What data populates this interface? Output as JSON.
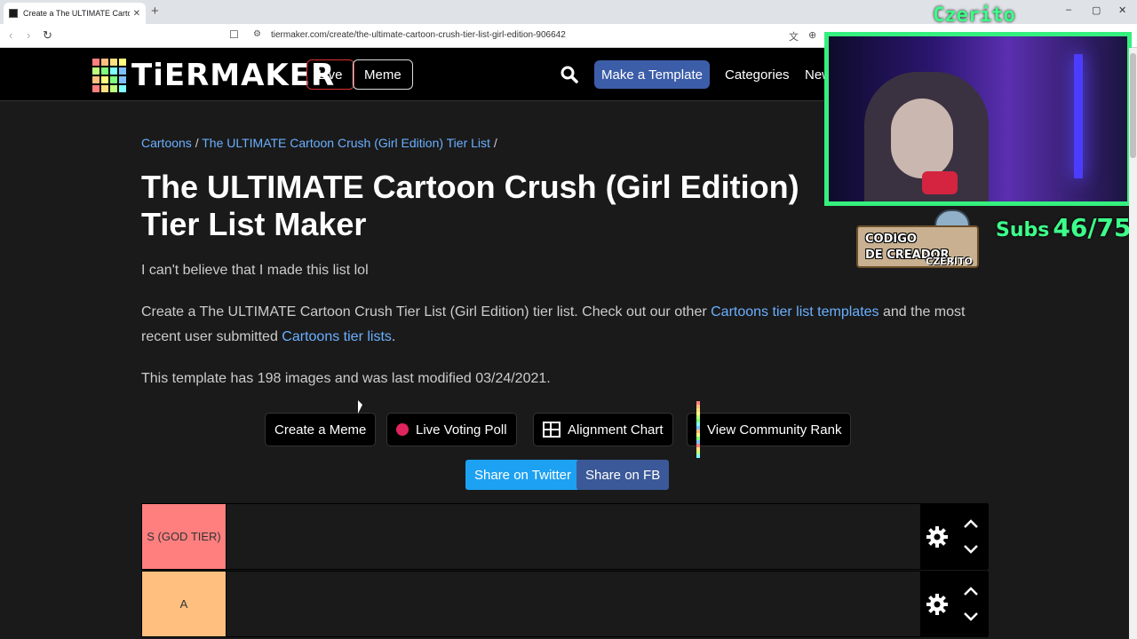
{
  "browser": {
    "tab_title": "Create a The ULTIMATE Cartoon",
    "tab_close": "✕",
    "new_tab": "+",
    "url": "tiermaker.com/create/the-ultimate-cartoon-crush-tier-list-girl-edition-906642",
    "back": "‹",
    "forward": "›",
    "reload": "↻",
    "bookmark": "☐",
    "site_info": "⚙",
    "translate": "文",
    "zoom": "⊕",
    "minimize": "–",
    "maximize": "▢",
    "close": "✕"
  },
  "header": {
    "logo_text": "TiERMAKER",
    "logo_colors": [
      "#ff7f7f",
      "#ffbf7f",
      "#ffdf7f",
      "#ffff7f",
      "#bfff7f",
      "#7fff7f",
      "#7fffff",
      "#7fbfff",
      "#ffbf7f",
      "#ffff7f",
      "#7fff7f",
      "#7fbfff",
      "#ff7f7f",
      "#ffdf7f",
      "#bfff7f",
      "#7fffff"
    ],
    "live_label": "Live",
    "meme_label": "Meme",
    "make_template_label": "Make a Template",
    "categories_label": "Categories",
    "new_label": "New"
  },
  "breadcrumb": {
    "category": "Cartoons",
    "separator": "/",
    "list": "The ULTIMATE Cartoon Crush (Girl Edition) Tier List",
    "trailing": "/"
  },
  "page_title": "The ULTIMATE Cartoon Crush (Girl Edition) Tier List Maker",
  "description": "I can't believe that I made this list lol",
  "info": {
    "part1": "Create a The ULTIMATE Cartoon Crush Tier List (Girl Edition) tier list. Check out our other ",
    "link1": "Cartoons tier list templates",
    "part2": " and the most recent user submitted ",
    "link2": "Cartoons tier lists",
    "part3": "."
  },
  "meta_text": "This template has 198 images and was last modified 03/24/2021.",
  "actions": {
    "create_meme": "Create a Meme",
    "live_voting": "Live Voting Poll",
    "alignment_chart": "Alignment Chart",
    "community_rank": "View Community Rank"
  },
  "share": {
    "twitter": "Share on Twitter",
    "facebook": "Share on FB"
  },
  "tiers": [
    {
      "label": "S (GOD TIER)",
      "color": "#ff7f7f"
    },
    {
      "label": "A",
      "color": "#ffbf7f"
    }
  ],
  "overlay": {
    "streamer_name": "Czerito",
    "code_line1": "CODIGO",
    "code_line2": "DE CREADOR",
    "code_name": "CZERITO",
    "subs_label": "Subs",
    "subs_value": "46/75",
    "accent": "#35f07e"
  }
}
